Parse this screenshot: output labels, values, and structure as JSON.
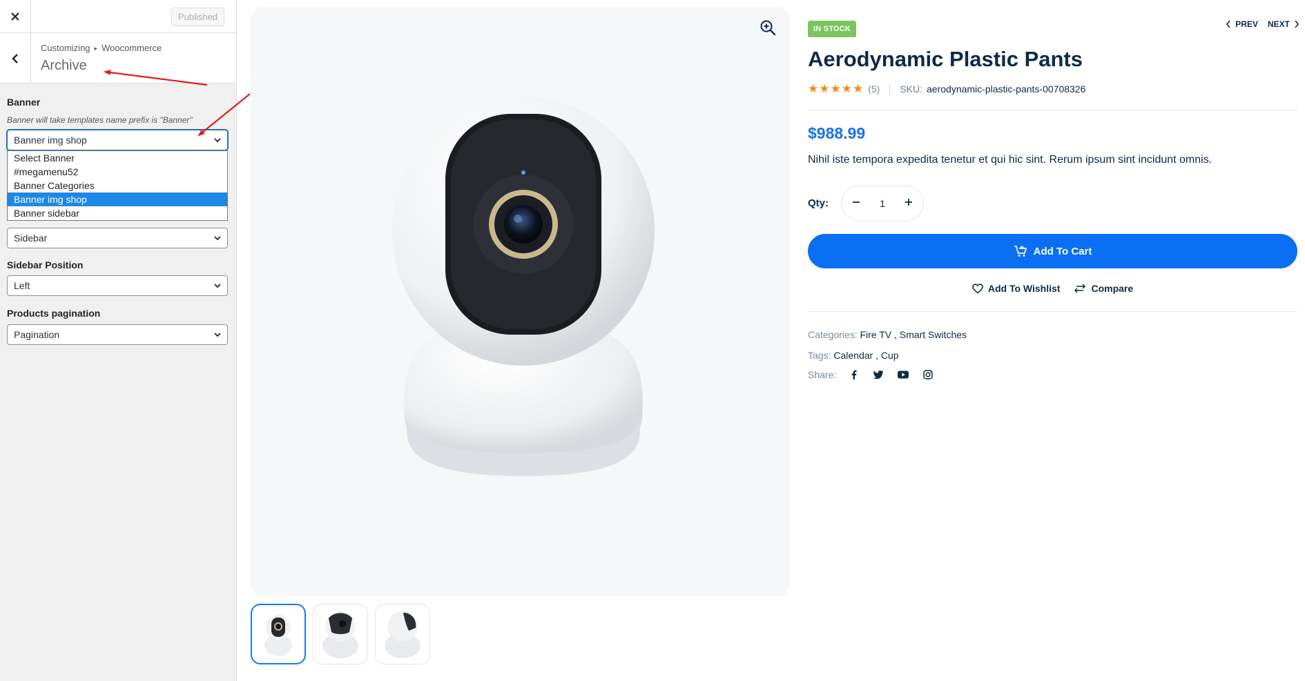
{
  "customizer": {
    "publish_label": "Published",
    "breadcrumb_root": "Customizing",
    "breadcrumb_sep": "▸",
    "breadcrumb_panel": "Woocommerce",
    "section_title": "Archive",
    "banner": {
      "label": "Banner",
      "description": "Banner will take templates name prefix is \"Banner\"",
      "value": "Banner img shop",
      "options": [
        "Select Banner",
        "#megamenu52",
        "Banner Categories",
        "Banner img shop",
        "Banner sidebar"
      ],
      "selected_index": 3
    },
    "sidebar_select": {
      "value": "Sidebar"
    },
    "sidebar_position": {
      "label": "Sidebar Position",
      "value": "Left"
    },
    "pagination": {
      "label": "Products pagination",
      "value": "Pagination"
    }
  },
  "product": {
    "stock": "IN STOCK",
    "nav_prev": "PREV",
    "nav_next": "NEXT",
    "title": "Aerodynamic Plastic Pants",
    "stars": "★★★★★",
    "rating_count": "(5)",
    "sku_label": "SKU:",
    "sku": "aerodynamic-plastic-pants-00708326",
    "price": "$988.99",
    "description": "Nihil iste tempora expedita tenetur et qui hic sint. Rerum ipsum sint incidunt omnis.",
    "qty_label": "Qty:",
    "qty": "1",
    "add_to_cart": "Add To Cart",
    "wishlist": "Add To Wishlist",
    "compare": "Compare",
    "categories_label": "Categories:",
    "categories": "Fire TV , Smart Switches",
    "tags_label": "Tags:",
    "tags": "Calendar , Cup",
    "share_label": "Share:",
    "share_icons": [
      "facebook-icon",
      "twitter-icon",
      "youtube-icon",
      "instagram-icon"
    ]
  },
  "colors": {
    "primary": "#0a6ff2",
    "price": "#1774e6",
    "stock_badge": "#7dc35f",
    "annotation_arrow": "#e11d1d",
    "dropdown_highlight": "#1e88e5"
  }
}
